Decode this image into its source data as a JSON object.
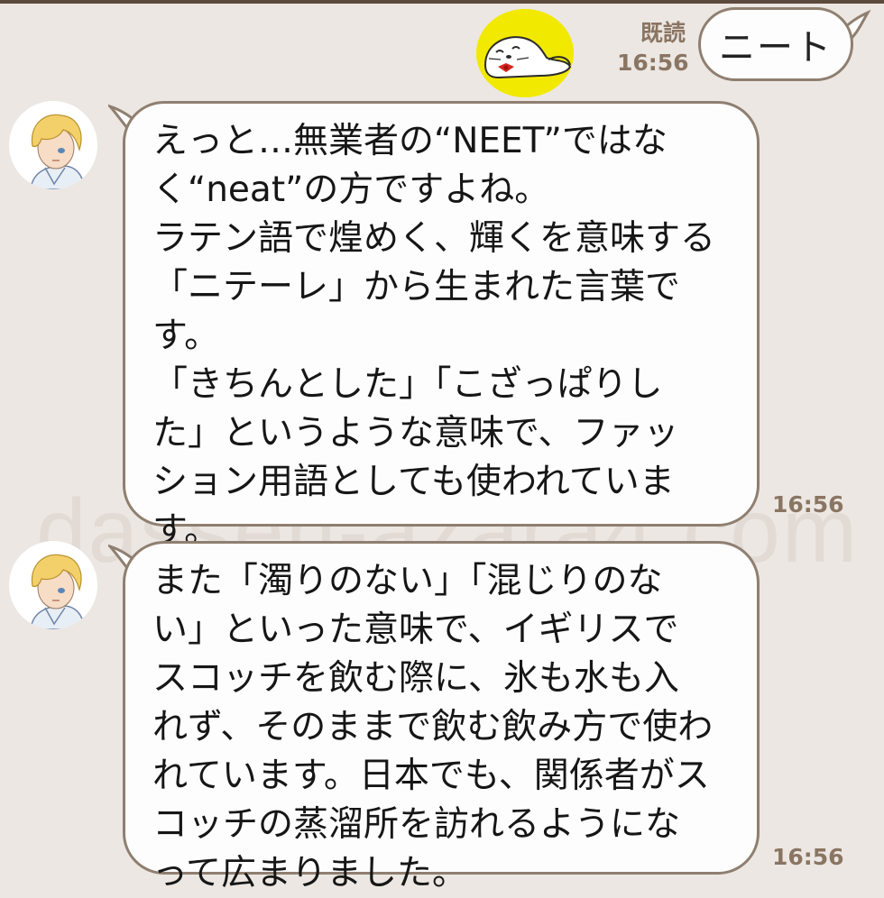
{
  "chat": {
    "outgoing": {
      "read_label": "既読",
      "time": "16:56",
      "text": "ニート",
      "avatar_icon": "seal-sticker-icon"
    },
    "incoming": [
      {
        "text": "えっと…無業者の“NEET”ではな\nく“neat”の方ですよね。\nラテン語で煌めく、輝くを意味する\n「ニテーレ」から生まれた言葉で\nす。\n「きちんとした」「こざっぱりし\nた」というような意味で、ファッ\nション用語としても使われていま\nす。",
        "time": "16:56",
        "avatar_icon": "blond-boy-avatar-icon"
      },
      {
        "text": "また「濁りのない」「混じりのな\nい」といった意味で、イギリスで\nスコッチを飲む際に、氷も水も入\nれず、そのままで飲む飲み方で使わ\nれています。日本でも、関係者がス\nコッチの蒸溜所を訪れるようにな\nって広まりました。",
        "time": "16:56",
        "avatar_icon": "blond-boy-avatar-icon"
      }
    ]
  },
  "watermark": "dassen-azara4.com",
  "colors": {
    "background": "#ece7e2",
    "bubble_border": "#8f7f70",
    "meta_text": "#8a7563",
    "sticker_yellow": "#f2e900"
  }
}
